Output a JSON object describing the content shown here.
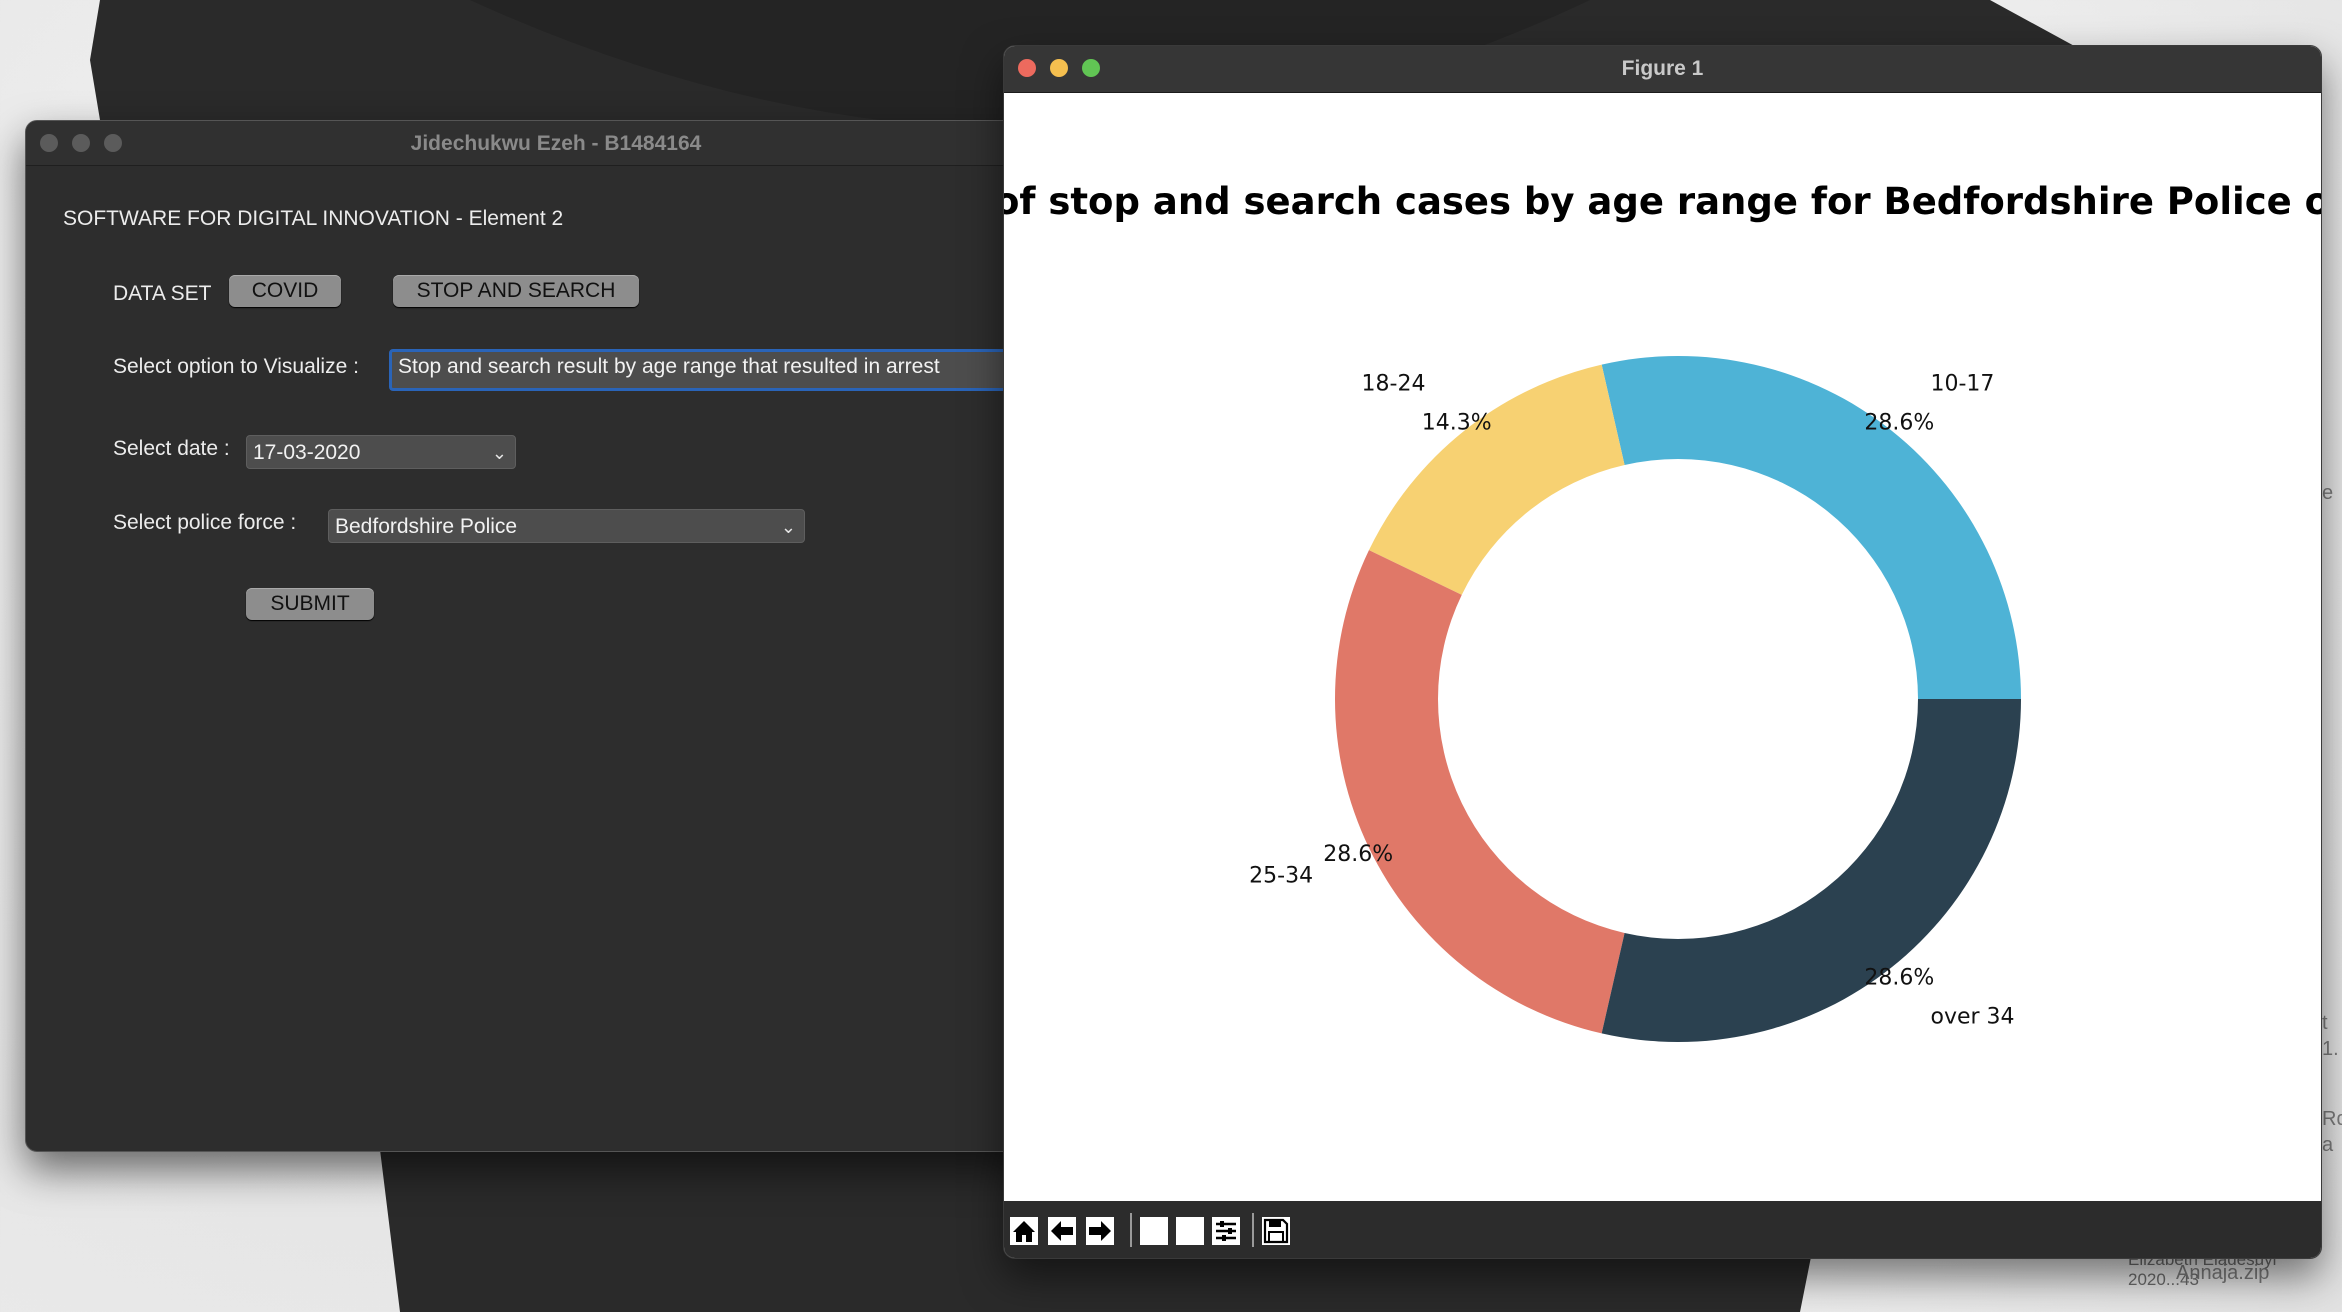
{
  "desktop": {
    "fragments": [
      "e",
      "t",
      "1.",
      "Rd",
      "a",
      "Elizabeth Eladesuyi 2020...43",
      "Annaja.zip"
    ]
  },
  "tk_window": {
    "title": "Jidechukwu Ezeh - B1484164",
    "heading": "SOFTWARE FOR DIGITAL INNOVATION - Element 2",
    "data_set_label": "DATA SET",
    "covid_button": "COVID",
    "stop_search_button": "STOP AND SEARCH",
    "visualize_label": "Select option to Visualize :",
    "visualize_value": "Stop and search result by age range that resulted in arrest",
    "date_label": "Select date :",
    "date_value": "17-03-2020",
    "police_label": "Select police force :",
    "police_value": "Bedfordshire Police",
    "submit_button": "SUBMIT"
  },
  "figure_window": {
    "title": "Figure 1",
    "toolbar": [
      {
        "icon": "home-icon"
      },
      {
        "icon": "back-arrow-icon"
      },
      {
        "icon": "forward-arrow-icon"
      },
      {
        "icon": "pan-icon"
      },
      {
        "icon": "zoom-icon"
      },
      {
        "icon": "configure-subplots-icon"
      },
      {
        "icon": "save-icon"
      }
    ]
  },
  "chart_data": {
    "type": "pie",
    "donut": true,
    "title": "of stop and search cases by age range for Bedfordshire Police o",
    "slices": [
      {
        "label": "10-17",
        "pct_label": "28.6%",
        "value": 28.6,
        "color": "#4eb3d6"
      },
      {
        "label": "18-24",
        "pct_label": "14.3%",
        "value": 14.3,
        "color": "#f7d172"
      },
      {
        "label": "25-34",
        "pct_label": "28.6%",
        "value": 28.6,
        "color": "#e07868"
      },
      {
        "label": "over 34",
        "pct_label": "28.6%",
        "value": 28.6,
        "color": "#2b4150"
      }
    ]
  },
  "colors": {
    "window_bg": "#2d2d2d",
    "figure_bg": "#ffffff",
    "accent_focus": "#2a64b8",
    "traffic_red": "#ed6a5e",
    "traffic_yellow": "#f5bf4f",
    "traffic_green": "#61c554"
  }
}
